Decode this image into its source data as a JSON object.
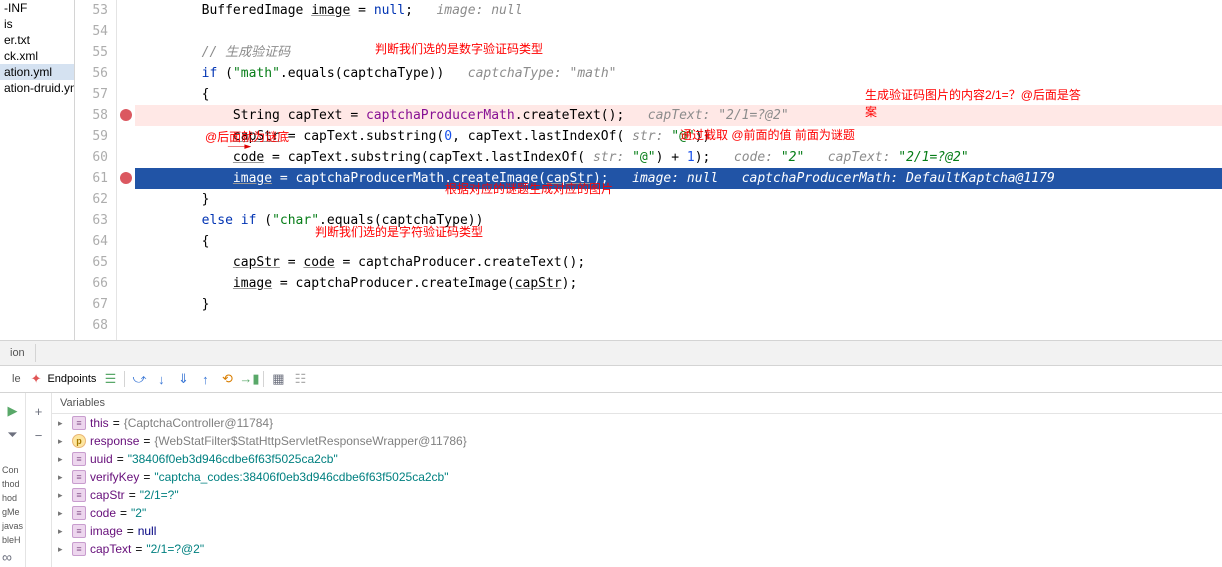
{
  "sidebar": {
    "items": [
      {
        "label": "-INF"
      },
      {
        "label": "is"
      },
      {
        "label": "er.txt"
      },
      {
        "label": "ck.xml"
      },
      {
        "label": "ation.yml"
      },
      {
        "label": "ation-druid.yml"
      }
    ]
  },
  "gutter": [
    "53",
    "54",
    "55",
    "56",
    "57",
    "58",
    "59",
    "60",
    "61",
    "62",
    "63",
    "64",
    "65",
    "66",
    "67",
    "68"
  ],
  "code": {
    "l53": {
      "pre": "        BufferedImage ",
      "img": "image",
      "mid": " = ",
      "kw": "null",
      "end": ";   ",
      "hint": "image: null"
    },
    "l55": {
      "cm": "        // 生成验证码"
    },
    "l56": {
      "pre": "        ",
      "kw": "if",
      "p1": " (",
      "s1": "\"math\"",
      "p2": ".equals(",
      "v": "captchaType",
      "p3": "))   ",
      "hint": "captchaType: \"math\""
    },
    "l57": "        {",
    "l58": {
      "pre": "            String capText = ",
      "prod": "captchaProducerMath",
      "p1": ".createText();   ",
      "hint": "capText: \"2/1=?@2\""
    },
    "l59": {
      "pre": "            ",
      "u": "capStr",
      "p1": " = capText.substring(",
      "n1": "0",
      "p2": ", capText.lastIndexOf( ",
      "hs": "str:",
      "s1": " \"@\"",
      "p3": "))"
    },
    "l60": {
      "pre": "            ",
      "u": "code",
      "p1": " = capText.substring(capText.lastIndexOf( ",
      "hs": "str:",
      "s1": " \"@\"",
      "p2": ") + ",
      "n1": "1",
      "p3": ");   ",
      "h1": "code: ",
      "hv1": "\"2\"",
      "h2": "   capText: ",
      "hv2": "\"2/1=?@2\""
    },
    "l61": {
      "pre": "            ",
      "u": "image",
      "p1": " = ",
      "prod": "captchaProducerMath",
      "p2": ".createImage(",
      "u2": "capStr",
      "p3": ");   ",
      "h1": "image: null   captchaProducerMath: DefaultKaptcha@1179"
    },
    "l62": "        }",
    "l63": {
      "pre": "        ",
      "kw": "else if",
      "p1": " (",
      "s1": "\"char\"",
      "p2": ".equals(",
      "v": "captchaType",
      "p3": "))"
    },
    "l64": "        {",
    "l65": {
      "pre": "            ",
      "u1": "capStr",
      "p1": " = ",
      "u2": "code",
      "p2": " = captchaProducer.createText();"
    },
    "l66": {
      "pre": "            ",
      "u1": "image",
      "p1": " = captchaProducer.createImage(",
      "u2": "capStr",
      "p2": ");"
    },
    "l67": "        }"
  },
  "annos": {
    "a1": "判断我们选的是数字验证码类型",
    "a2": "生成验证码图片的内容2/1=？@后面是答\n案",
    "a3": "@后面就为谜底",
    "a4": "通过截取 @前面的值 前面为谜题",
    "a5": "根据对应的谜题生成对应的图片",
    "a6": "判断我们选的是字符验证码类型"
  },
  "bottom": {
    "tab1": "ion",
    "tab2": "le",
    "endpoints": "Endpoints",
    "vars_hdr": "Variables",
    "vars": [
      {
        "name": "this",
        "val": "{CaptchaController@11784}",
        "type": "obj"
      },
      {
        "name": "response",
        "val": "{WebStatFilter$StatHttpServletResponseWrapper@11786}",
        "type": "obj"
      },
      {
        "name": "uuid",
        "val": "\"38406f0eb3d946cdbe6f63f5025ca2cb\"",
        "type": "str"
      },
      {
        "name": "verifyKey",
        "val": "\"captcha_codes:38406f0eb3d946cdbe6f63f5025ca2cb\"",
        "type": "str"
      },
      {
        "name": "capStr",
        "val": "\"2/1=?\"",
        "type": "str"
      },
      {
        "name": "code",
        "val": "\"2\"",
        "type": "str"
      },
      {
        "name": "image",
        "val": "null",
        "type": "null"
      },
      {
        "name": "capText",
        "val": "\"2/1=?@2\"",
        "type": "str"
      }
    ]
  },
  "leftstrip": [
    "Con",
    "thod",
    "hod",
    "gMe",
    "javas",
    "bleH"
  ]
}
